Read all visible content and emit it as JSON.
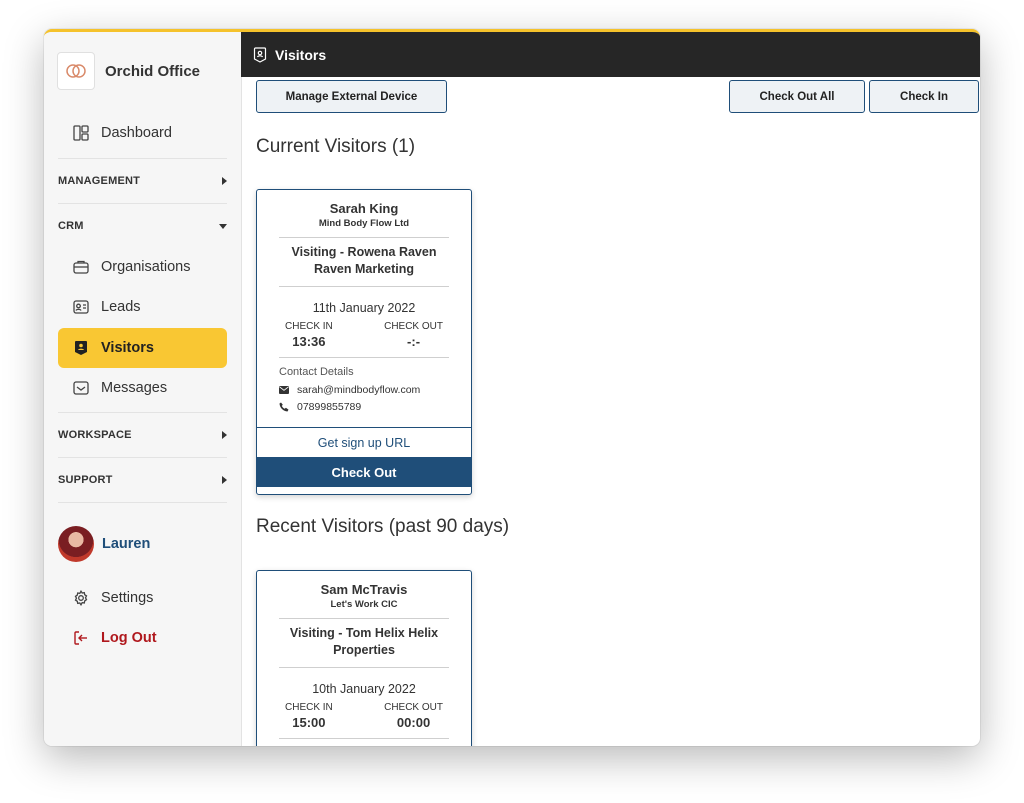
{
  "brand": {
    "name": "Orchid Office",
    "logo_icon": "orchid-logo"
  },
  "sidebar": {
    "dashboard": "Dashboard",
    "sections": {
      "management": "MANAGEMENT",
      "crm": "CRM",
      "workspace": "WORKSPACE",
      "support": "SUPPORT"
    },
    "crm_items": [
      "Organisations",
      "Leads",
      "Visitors",
      "Messages"
    ],
    "active_item": "Visitors",
    "user": {
      "name": "Lauren"
    },
    "settings": "Settings",
    "logout": "Log Out"
  },
  "topbar": {
    "title": "Visitors"
  },
  "toolbar": {
    "manage_device": "Manage External Device",
    "check_out_all": "Check Out All",
    "check_in": "Check In"
  },
  "current": {
    "heading": "Current Visitors (1)",
    "card": {
      "name": "Sarah King",
      "org": "Mind Body Flow Ltd",
      "visiting": "Visiting - Rowena Raven Raven Marketing",
      "date": "11th January 2022",
      "check_in_label": "CHECK IN",
      "check_in": "13:36",
      "check_out_label": "CHECK OUT",
      "check_out": "-:-",
      "contact_heading": "Contact Details",
      "email": "sarah@mindbodyflow.com",
      "phone": "07899855789",
      "signup": "Get sign up URL",
      "checkout_btn": "Check Out"
    }
  },
  "recent": {
    "heading": "Recent Visitors (past 90 days)",
    "card": {
      "name": "Sam McTravis",
      "org": "Let's Work CIC",
      "visiting": "Visiting - Tom Helix Helix Properties",
      "date": "10th January 2022",
      "check_in_label": "CHECK IN",
      "check_in": "15:00",
      "check_out_label": "CHECK OUT",
      "check_out": "00:00"
    }
  },
  "colors": {
    "accent": "#f9c733",
    "primary": "#1f4e79",
    "topbar": "#262626",
    "danger": "#b0181d"
  }
}
